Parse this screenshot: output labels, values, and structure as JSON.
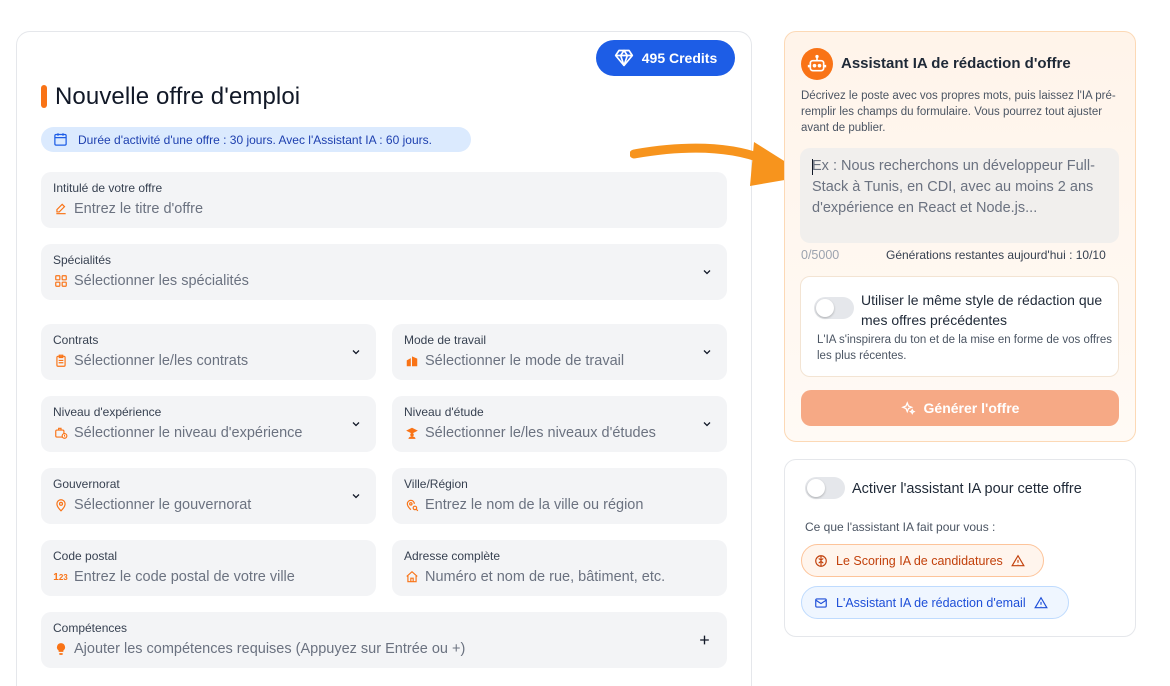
{
  "header": {
    "credits_label": "495 Credits",
    "page_title": "Nouvelle offre d'emploi",
    "duration_note": "Durée d'activité d'une offre : 30 jours. Avec l'Assistant IA : 60 jours."
  },
  "form": {
    "title": {
      "label": "Intitulé de votre offre",
      "placeholder": "Entrez le titre d'offre"
    },
    "specialites": {
      "label": "Spécialités",
      "placeholder": "Sélectionner les spécialités"
    },
    "contrats": {
      "label": "Contrats",
      "placeholder": "Sélectionner le/les contrats"
    },
    "mode_travail": {
      "label": "Mode de travail",
      "placeholder": "Sélectionner le mode de travail"
    },
    "experience": {
      "label": "Niveau d'expérience",
      "placeholder": "Sélectionner le niveau d'expérience"
    },
    "etude": {
      "label": "Niveau d'étude",
      "placeholder": "Sélectionner le/les niveaux d'études"
    },
    "gouvernorat": {
      "label": "Gouvernorat",
      "placeholder": "Sélectionner le gouvernorat"
    },
    "ville": {
      "label": "Ville/Région",
      "placeholder": "Entrez le nom de la ville ou région"
    },
    "code_postal": {
      "label": "Code postal",
      "placeholder": "Entrez le code postal de votre ville"
    },
    "adresse": {
      "label": "Adresse complète",
      "placeholder": "Numéro et nom de rue, bâtiment, etc."
    },
    "competences": {
      "label": "Compétences",
      "placeholder": "Ajouter les compétences requises (Appuyez sur Entrée ou +)"
    }
  },
  "ai_panel": {
    "title": "Assistant IA de rédaction d'offre",
    "description": "Décrivez le poste avec vos propres mots, puis laissez l'IA pré-remplir les champs du formulaire. Vous pourrez tout ajuster avant de publier.",
    "textarea_placeholder": "Ex : Nous recherchons un développeur Full-Stack à Tunis, en CDI, avec au moins 2 ans d'expérience en React et Node.js...",
    "char_counter": "0/5000",
    "generations_left": "Générations restantes aujourd'hui : 10/10",
    "style_toggle_label": "Utiliser le même style de rédaction que mes offres précédentes",
    "style_toggle_desc": "L'IA s'inspirera du ton et de la mise en forme de vos offres les plus récentes.",
    "generate_label": "Générer l'offre"
  },
  "activate_panel": {
    "toggle_label": "Activer l'assistant IA pour cette offre",
    "subtitle": "Ce que l'assistant IA fait pour vous :",
    "features": [
      "Le Scoring IA de candidatures",
      "L'Assistant IA de rédaction d'email"
    ]
  },
  "colors": {
    "primary_blue": "#1d5de6",
    "accent_orange": "#f97316",
    "generate_button": "#f6a985"
  }
}
